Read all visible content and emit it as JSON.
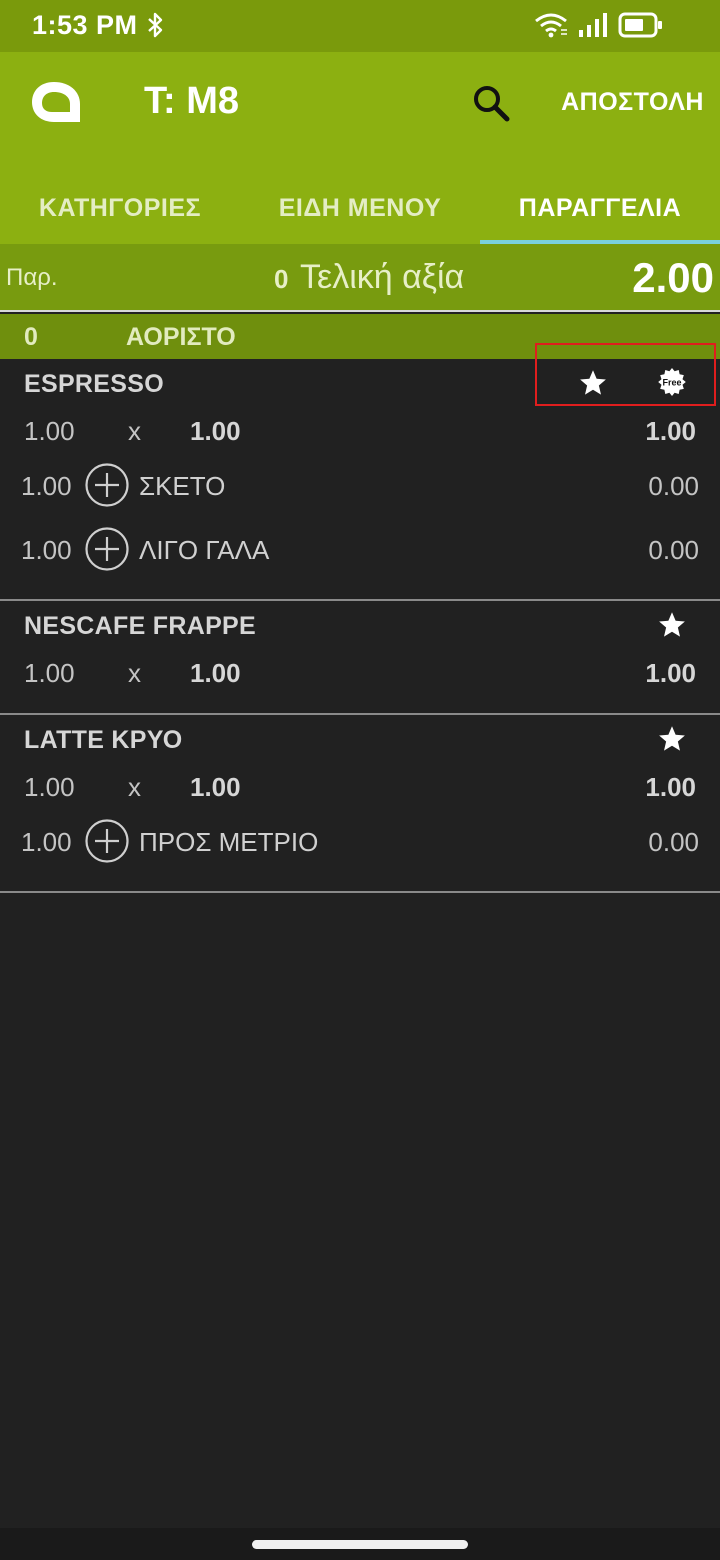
{
  "status": {
    "time": "1:53 PM"
  },
  "appbar": {
    "title": "T: M8",
    "send_label": "ΑΠΟΣΤΟΛΗ"
  },
  "tabs": [
    {
      "label": "ΚΑΤΗΓΟΡΙΕΣ"
    },
    {
      "label": "ΕΙΔΗ ΜΕΝΟΥ"
    },
    {
      "label": "ΠΑΡΑΓΓΕΛΙΑ"
    }
  ],
  "summary": {
    "par_label": "Παρ.",
    "par_count": "0",
    "total_label": "Τελική αξία",
    "total_value": "2.00"
  },
  "group": {
    "count": "0",
    "name": "ΑΟΡΙΣΤΟ"
  },
  "items": [
    {
      "name": "ESPRESSO",
      "qty": "1.00",
      "times": "x",
      "price": "1.00",
      "total": "1.00",
      "modifiers": [
        {
          "qty": "1.00",
          "name": "ΣΚΕΤΟ",
          "price": "0.00"
        },
        {
          "qty": "1.00",
          "name": "ΛΙΓΟ ΓΑΛΑ",
          "price": "0.00"
        }
      ],
      "free_badge": "Free"
    },
    {
      "name": "NESCAFE FRAPPE",
      "qty": "1.00",
      "times": "x",
      "price": "1.00",
      "total": "1.00",
      "modifiers": []
    },
    {
      "name": "LATTE ΚΡΥΟ",
      "qty": "1.00",
      "times": "x",
      "price": "1.00",
      "total": "1.00",
      "modifiers": [
        {
          "qty": "1.00",
          "name": "ΠΡΟΣ ΜΕΤΡΙΟ",
          "price": "0.00"
        }
      ]
    }
  ],
  "icons": {
    "logo": "app-logo-icon",
    "search": "search-icon",
    "star": "star-icon",
    "free": "free-badge-icon",
    "add": "plus-circle-icon",
    "wifi": "wifi-icon",
    "signal": "signal-icon",
    "battery": "battery-icon",
    "bluetooth": "bluetooth-icon"
  },
  "colors": {
    "appbar": "#8cb011",
    "statusbar": "#7a9a0c",
    "totalbar": "#789b0f",
    "group": "#6f8f0d",
    "background": "#212121",
    "tab_indicator": "#7ad0dd",
    "highlight": "#e01e1e"
  }
}
